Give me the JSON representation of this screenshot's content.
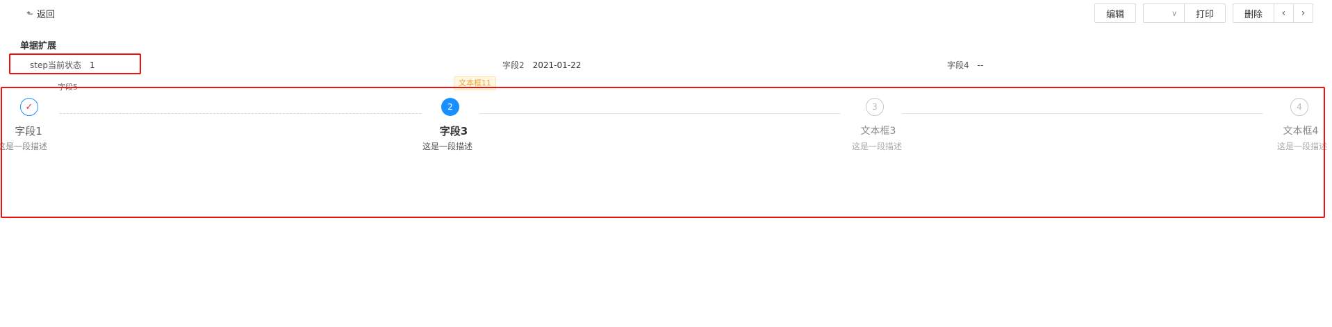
{
  "header": {
    "back_icon": "return-arrow-icon",
    "back_label": "返回"
  },
  "toolbar": {
    "edit_label": "编辑",
    "dropdown_icon": "chevron-down-icon",
    "print_label": "打印",
    "delete_label": "删除",
    "prev_icon": "chevron-left-icon",
    "next_icon": "chevron-right-icon"
  },
  "section": {
    "title": "单据扩展"
  },
  "fields": {
    "step_label": "step当前状态",
    "step_value": "1",
    "field2_label": "字段2",
    "field2_value": "2021-01-22",
    "field4_label": "字段4",
    "field4_value": "--",
    "field5_label": "字段5",
    "tag_label": "文本框11"
  },
  "steps": [
    {
      "status": "finish",
      "icon": "check-icon",
      "title": "字段1",
      "description": "这是一段描述"
    },
    {
      "status": "process",
      "number": "2",
      "title": "字段3",
      "description": "这是一段描述"
    },
    {
      "status": "wait",
      "number": "3",
      "title": "文本框3",
      "description": "这是一段描述"
    },
    {
      "status": "wait",
      "number": "4",
      "title": "文本框4",
      "description": "这是一段描述"
    }
  ],
  "colors": {
    "primary": "#1890ff",
    "highlight_border": "#ee1111",
    "check_mark": "#f5222d",
    "tag_text": "#e8a33d"
  }
}
